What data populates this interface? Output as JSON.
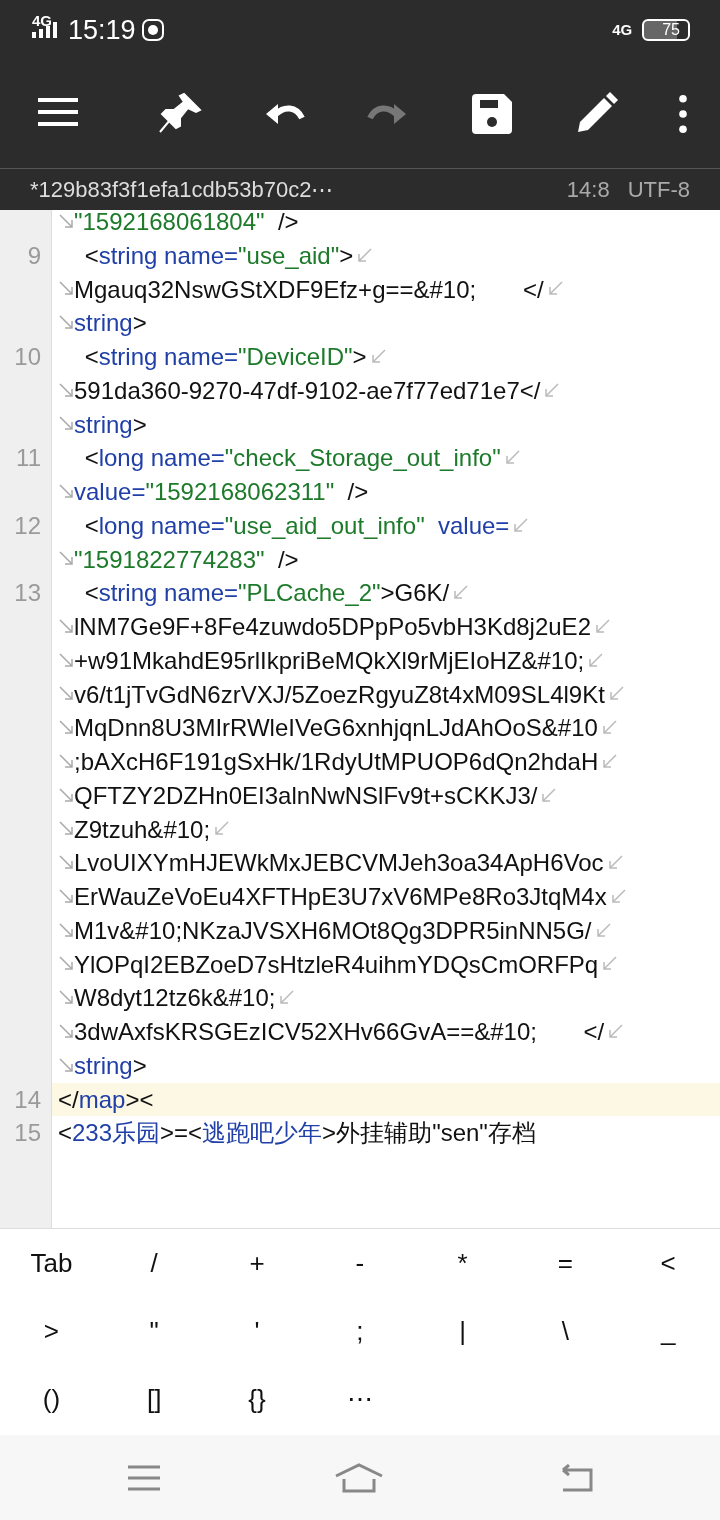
{
  "status_bar": {
    "network_left": "4G",
    "time": "15:19",
    "network_right": "4G",
    "battery": "75"
  },
  "toolbar": [
    {
      "kind": "menu",
      "disabled": false
    },
    {
      "kind": "pin",
      "disabled": false
    },
    {
      "kind": "undo",
      "disabled": false
    },
    {
      "kind": "redo",
      "disabled": true
    },
    {
      "kind": "save",
      "disabled": false
    },
    {
      "kind": "edit",
      "disabled": false
    },
    {
      "kind": "more",
      "disabled": false
    }
  ],
  "file_bar": {
    "title": "*129b83f3f1efa1cdb53b70c2⋯",
    "cursor": "14:8",
    "encoding": "UTF-8"
  },
  "editor": {
    "lines": [
      {
        "continued": true,
        "current": false,
        "rows": [
          {
            "spans": [
              {
                "kind": "string",
                "text": "\"1592168061804\""
              },
              {
                "kind": "plain",
                "text": "  />"
              }
            ]
          }
        ]
      },
      {
        "number": "9",
        "continued": false,
        "current": false,
        "rows": [
          {
            "spans": [
              {
                "kind": "plain",
                "text": "    <"
              },
              {
                "kind": "name",
                "text": "string name="
              },
              {
                "kind": "string",
                "text": "\"use_aid\""
              },
              {
                "kind": "plain",
                "text": ">"
              }
            ]
          },
          {
            "spans": [
              {
                "kind": "plain",
                "text": "Mgauq32NswGStXDF9Efz+g==&#10;       </"
              }
            ]
          },
          {
            "spans": [
              {
                "kind": "name",
                "text": "string"
              },
              {
                "kind": "plain",
                "text": ">"
              }
            ]
          }
        ]
      },
      {
        "number": "10",
        "continued": false,
        "current": false,
        "rows": [
          {
            "spans": [
              {
                "kind": "plain",
                "text": "    <"
              },
              {
                "kind": "name",
                "text": "string name="
              },
              {
                "kind": "string",
                "text": "\"DeviceID\""
              },
              {
                "kind": "plain",
                "text": ">"
              }
            ]
          },
          {
            "spans": [
              {
                "kind": "plain",
                "text": "591da360-9270-47df-9102-ae7f77ed71e7</"
              }
            ]
          },
          {
            "spans": [
              {
                "kind": "name",
                "text": "string"
              },
              {
                "kind": "plain",
                "text": ">"
              }
            ]
          }
        ]
      },
      {
        "number": "11",
        "continued": false,
        "current": false,
        "rows": [
          {
            "spans": [
              {
                "kind": "plain",
                "text": "    <"
              },
              {
                "kind": "name",
                "text": "long name="
              },
              {
                "kind": "string",
                "text": "\"check_Storage_out_info\""
              }
            ]
          },
          {
            "spans": [
              {
                "kind": "name",
                "text": "value="
              },
              {
                "kind": "string",
                "text": "\"1592168062311\""
              },
              {
                "kind": "plain",
                "text": "  />"
              }
            ]
          }
        ]
      },
      {
        "number": "12",
        "continued": false,
        "current": false,
        "rows": [
          {
            "spans": [
              {
                "kind": "plain",
                "text": "    <"
              },
              {
                "kind": "name",
                "text": "long name="
              },
              {
                "kind": "string",
                "text": "\"use_aid_out_info\""
              },
              {
                "kind": "name",
                "text": "  value="
              }
            ]
          },
          {
            "spans": [
              {
                "kind": "string",
                "text": "\"1591822774283\""
              },
              {
                "kind": "plain",
                "text": "  />"
              }
            ]
          }
        ]
      },
      {
        "number": "13",
        "continued": false,
        "current": false,
        "rows": [
          {
            "spans": [
              {
                "kind": "plain",
                "text": "    <"
              },
              {
                "kind": "name",
                "text": "string name="
              },
              {
                "kind": "string",
                "text": "\"PLCache_2\""
              },
              {
                "kind": "plain",
                "text": ">G6K/"
              }
            ]
          },
          {
            "spans": [
              {
                "kind": "plain",
                "text": "lNM7Ge9F+8Fe4zuwdo5DPpPo5vbH3Kd8j2uE2"
              }
            ]
          },
          {
            "spans": [
              {
                "kind": "plain",
                "text": "+w91MkahdE95rlIkpriBeMQkXl9rMjEIoHZ&#10;"
              }
            ]
          },
          {
            "spans": [
              {
                "kind": "plain",
                "text": "v6/t1jTvGdN6zrVXJ/5ZoezRgyuZ8t4xM09SL4l9Kt"
              }
            ]
          },
          {
            "spans": [
              {
                "kind": "plain",
                "text": "MqDnn8U3MIrRWleIVeG6xnhjqnLJdAhOoS&#10"
              }
            ]
          },
          {
            "spans": [
              {
                "kind": "plain",
                "text": ";bAXcH6F191gSxHk/1RdyUtMPUOP6dQn2hdaH"
              }
            ]
          },
          {
            "spans": [
              {
                "kind": "plain",
                "text": "QFTZY2DZHn0EI3alnNwNSlFv9t+sCKKJ3/"
              }
            ]
          },
          {
            "spans": [
              {
                "kind": "plain",
                "text": "Z9tzuh&#10;"
              }
            ]
          },
          {
            "spans": [
              {
                "kind": "plain",
                "text": "LvoUIXYmHJEWkMxJEBCVMJeh3oa34ApH6Voc"
              }
            ]
          },
          {
            "spans": [
              {
                "kind": "plain",
                "text": "ErWauZeVoEu4XFTHpE3U7xV6MPe8Ro3JtqM4x"
              }
            ]
          },
          {
            "spans": [
              {
                "kind": "plain",
                "text": "M1v&#10;NKzaJVSXH6MOt8Qg3DPR5inNN5G/"
              }
            ]
          },
          {
            "spans": [
              {
                "kind": "plain",
                "text": "YlOPqI2EBZoeD7sHtzleR4uihmYDQsCmORFPq"
              }
            ]
          },
          {
            "spans": [
              {
                "kind": "plain",
                "text": "W8dyt12tz6k&#10;"
              }
            ]
          },
          {
            "spans": [
              {
                "kind": "plain",
                "text": "3dwAxfsKRSGEzICV52XHv66GvA==&#10;       </"
              }
            ]
          },
          {
            "spans": [
              {
                "kind": "name",
                "text": "string"
              },
              {
                "kind": "plain",
                "text": ">"
              }
            ]
          }
        ]
      },
      {
        "number": "14",
        "continued": false,
        "current": true,
        "rows": [
          {
            "spans": [
              {
                "kind": "plain",
                "text": "</"
              },
              {
                "kind": "name",
                "text": "map"
              },
              {
                "kind": "plain",
                "text": "><"
              }
            ]
          }
        ]
      },
      {
        "number": "15",
        "continued": false,
        "current": false,
        "rows": [
          {
            "spans": [
              {
                "kind": "plain",
                "text": "<"
              },
              {
                "kind": "name",
                "text": "233乐园"
              },
              {
                "kind": "plain",
                "text": ">=<"
              },
              {
                "kind": "name",
                "text": "逃跑吧少年"
              },
              {
                "kind": "plain",
                "text": ">外挂辅助\"sen\"存档"
              }
            ]
          }
        ]
      }
    ]
  },
  "keys": [
    [
      "Tab",
      "/",
      "+",
      "-",
      "*",
      "=",
      "<"
    ],
    [
      ">",
      "\"",
      "'",
      ";",
      "|",
      "\\",
      "_"
    ],
    [
      "()",
      "[]",
      "{}",
      "⋯"
    ]
  ]
}
